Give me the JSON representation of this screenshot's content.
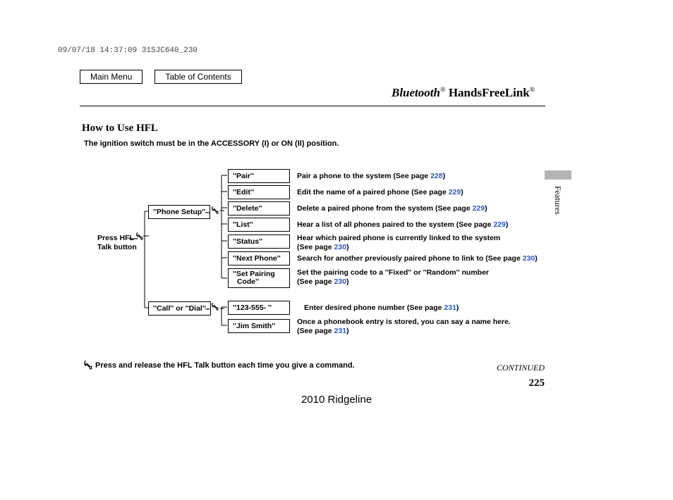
{
  "timestamp": "09/07/18 14:37:09 31SJC640_230",
  "nav": {
    "main": "Main Menu",
    "toc": "Table of Contents"
  },
  "title": {
    "bt": "Bluetooth",
    "reg": "®",
    "hfl": " HandsFreeLink",
    "reg2": "®"
  },
  "section_title": "How to Use HFL",
  "ignition_note": "The ignition switch must be in the ACCESSORY (I) or ON (II) position.",
  "root_label": "Press HFL\nTalk button",
  "level1": {
    "phone_setup": "''Phone Setup''",
    "call_dial": "''Call'' or ''Dial''"
  },
  "phone_setup_children": [
    {
      "cmd": "''Pair''",
      "desc": "Pair a phone to the system (See page ",
      "page": "228",
      "tail": ")"
    },
    {
      "cmd": "''Edit''",
      "desc": "Edit the name of a paired phone (See page ",
      "page": "229",
      "tail": ")"
    },
    {
      "cmd": "''Delete''",
      "desc": "Delete a paired phone from the system (See page ",
      "page": "229",
      "tail": ")"
    },
    {
      "cmd": "''List''",
      "desc": "Hear a list of all phones paired to the system (See page ",
      "page": "229",
      "tail": ")"
    },
    {
      "cmd": "''Status''",
      "desc": "Hear which paired phone is currently linked to the system\n(See page ",
      "page": "230",
      "tail": ")"
    },
    {
      "cmd": "''Next Phone''",
      "desc": "Search for another previously paired phone to link to (See page ",
      "page": "230",
      "tail": ")"
    },
    {
      "cmd": "''Set Pairing\n  Code''",
      "desc": "Set the pairing code to a ''Fixed'' or ''Random'' number\n(See page ",
      "page": "230",
      "tail": ")"
    }
  ],
  "call_children": [
    {
      "cmd": "''123-555-         ''",
      "desc": "Enter desired phone number (See page ",
      "page": "231",
      "tail": ")"
    },
    {
      "cmd": "''Jim Smith''",
      "desc": "Once a phonebook entry is stored, you can say a name here.\n(See page ",
      "page": "231",
      "tail": ")"
    }
  ],
  "footnote": "Press and release the HFL Talk button each time you give a command.",
  "continued": "CONTINUED",
  "page_number": "225",
  "vehicle": "2010 Ridgeline",
  "side_tab": "Features"
}
